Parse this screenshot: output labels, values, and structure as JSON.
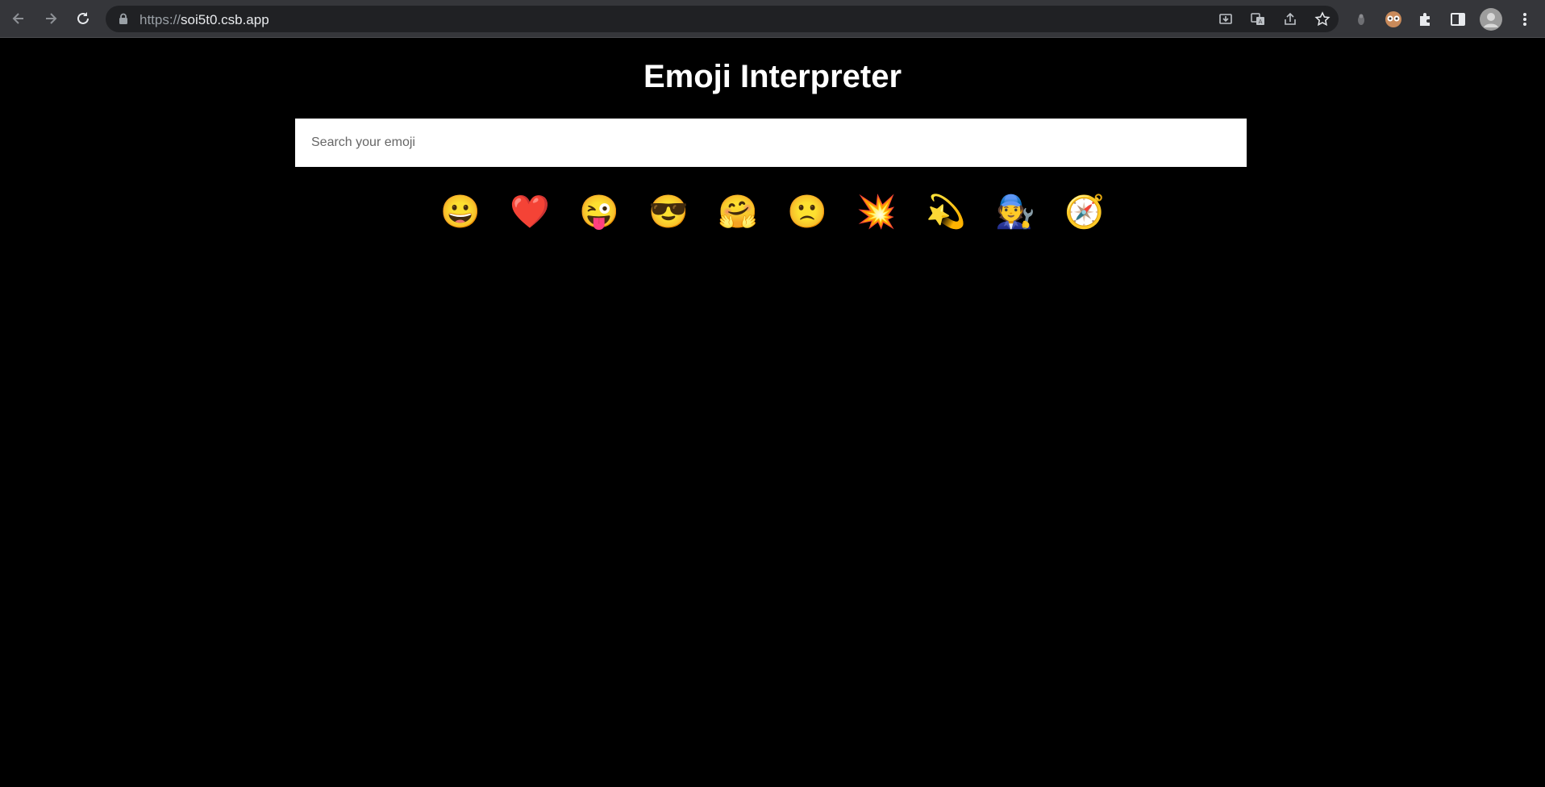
{
  "browser": {
    "url_scheme": "https://",
    "url_host": "soi5t0.csb.app"
  },
  "page": {
    "title": "Emoji Interpreter",
    "search": {
      "placeholder": "Search your emoji",
      "value": ""
    },
    "emojis": [
      "😀",
      "❤️",
      "😜",
      "😎",
      "🤗",
      "🙁",
      "💥",
      "💫",
      "🧑‍🔧",
      "🧭"
    ]
  }
}
